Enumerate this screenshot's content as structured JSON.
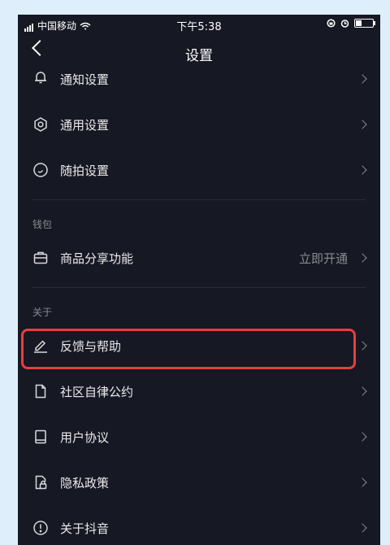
{
  "status": {
    "carrier": "中国移动",
    "time": "下午5:38"
  },
  "nav": {
    "title": "设置"
  },
  "items": [
    {
      "label": "通知设置"
    },
    {
      "label": "通用设置"
    },
    {
      "label": "随拍设置"
    }
  ],
  "wallet": {
    "section": "钱包",
    "item": {
      "label": "商品分享功能",
      "value": "立即开通"
    }
  },
  "about": {
    "section": "关于",
    "items": [
      {
        "label": "反馈与帮助"
      },
      {
        "label": "社区自律公约"
      },
      {
        "label": "用户协议"
      },
      {
        "label": "隐私政策"
      },
      {
        "label": "关于抖音"
      }
    ]
  },
  "colors": {
    "background": "#161823",
    "highlight": "#e3403d",
    "page": "#dfeefb"
  }
}
